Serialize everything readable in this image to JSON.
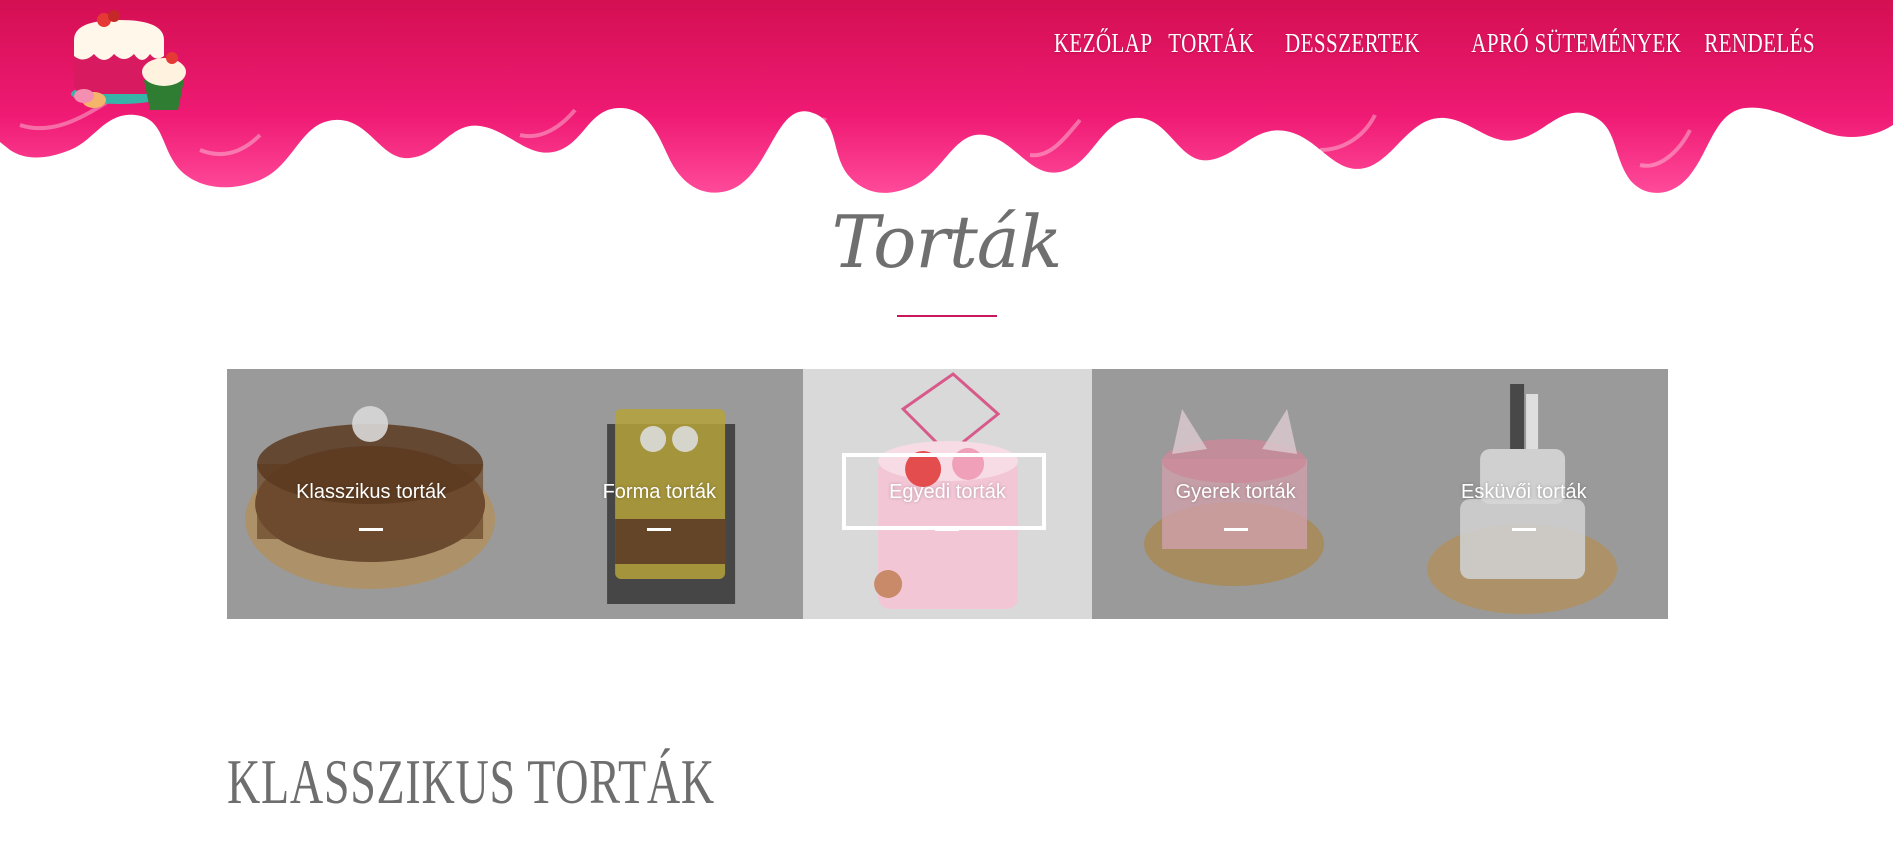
{
  "header": {
    "logo_icon": "cake-logo-icon",
    "nav": [
      {
        "label": "KEZŐLAP"
      },
      {
        "label": "TORTÁK"
      },
      {
        "label": "DESSZERTEK"
      },
      {
        "label": "APRÓ SÜTEMÉNYEK"
      },
      {
        "label": "RENDELÉS"
      }
    ]
  },
  "main": {
    "title": "Torták",
    "gallery": [
      {
        "label": "Klasszikus torták",
        "icon": "chocolate-cake-icon"
      },
      {
        "label": "Forma torták",
        "icon": "spongebob-cake-icon"
      },
      {
        "label": "Egyedi torták",
        "icon": "birthday-cake-icon",
        "active": true
      },
      {
        "label": "Gyerek torták",
        "icon": "cat-cake-icon"
      },
      {
        "label": "Esküvői torták",
        "icon": "wedding-cake-icon"
      }
    ],
    "section_title": "Klasszikus torták"
  },
  "colors": {
    "brand_pink": "#e6156a",
    "accent_rule": "#c8175a",
    "tile_gray": "#9a9a9a",
    "tile_active": "#d9d9d9",
    "text_gray": "#6e6e6e"
  }
}
